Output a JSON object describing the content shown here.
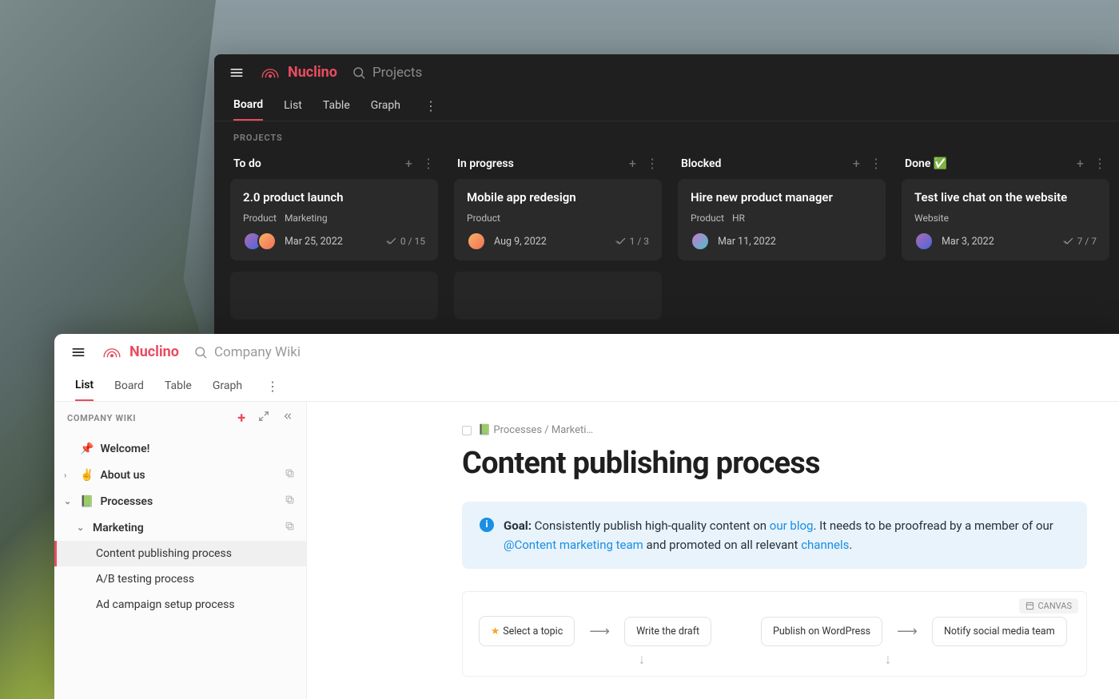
{
  "brand_name": "Nuclino",
  "dark": {
    "search_placeholder": "Projects",
    "tabs": [
      "Board",
      "List",
      "Table",
      "Graph"
    ],
    "active_tab": "Board",
    "section_label": "PROJECTS",
    "columns": [
      {
        "title": "To do",
        "cards": [
          {
            "title": "2.0 product launch",
            "tags": [
              "Product",
              "Marketing"
            ],
            "date": "Mar 25, 2022",
            "checks": "0 / 15",
            "avatars": 2
          }
        ]
      },
      {
        "title": "In progress",
        "cards": [
          {
            "title": "Mobile app redesign",
            "tags": [
              "Product"
            ],
            "date": "Aug 9, 2022",
            "checks": "1 / 3",
            "avatars": 1
          }
        ]
      },
      {
        "title": "Blocked",
        "cards": [
          {
            "title": "Hire new product manager",
            "tags": [
              "Product",
              "HR"
            ],
            "date": "Mar 11, 2022",
            "checks": "",
            "avatars": 1
          }
        ]
      },
      {
        "title": "Done ✅",
        "cards": [
          {
            "title": "Test live chat on the website",
            "tags": [
              "Website"
            ],
            "date": "Mar 3, 2022",
            "checks": "7 / 7",
            "avatars": 1
          }
        ]
      }
    ]
  },
  "light": {
    "search_placeholder": "Company Wiki",
    "tabs": [
      "List",
      "Board",
      "Table",
      "Graph"
    ],
    "active_tab": "List",
    "sidebar_label": "COMPANY WIKI",
    "tree": {
      "welcome": "Welcome!",
      "about": "About us",
      "about_emoji": "✌️",
      "processes": "Processes",
      "processes_emoji": "📗",
      "marketing": "Marketing",
      "items": [
        "Content publishing process",
        "A/B testing process",
        "Ad campaign setup process"
      ]
    },
    "breadcrumb": "📗 Processes / Marketi…",
    "page_title": "Content publishing process",
    "callout": {
      "goal_label": "Goal:",
      "text1": " Consistently publish high-quality content on ",
      "link1": "our blog",
      "text2": ". It needs to be proofread by a member of our ",
      "mention": "@Content marketing team",
      "text3": " and promoted on all relevant ",
      "link2": "channels",
      "text4": "."
    },
    "canvas_label": "CANVAS",
    "flow_nodes": [
      "Select a topic",
      "Write the draft",
      "Publish on WordPress",
      "Notify social media team"
    ]
  }
}
